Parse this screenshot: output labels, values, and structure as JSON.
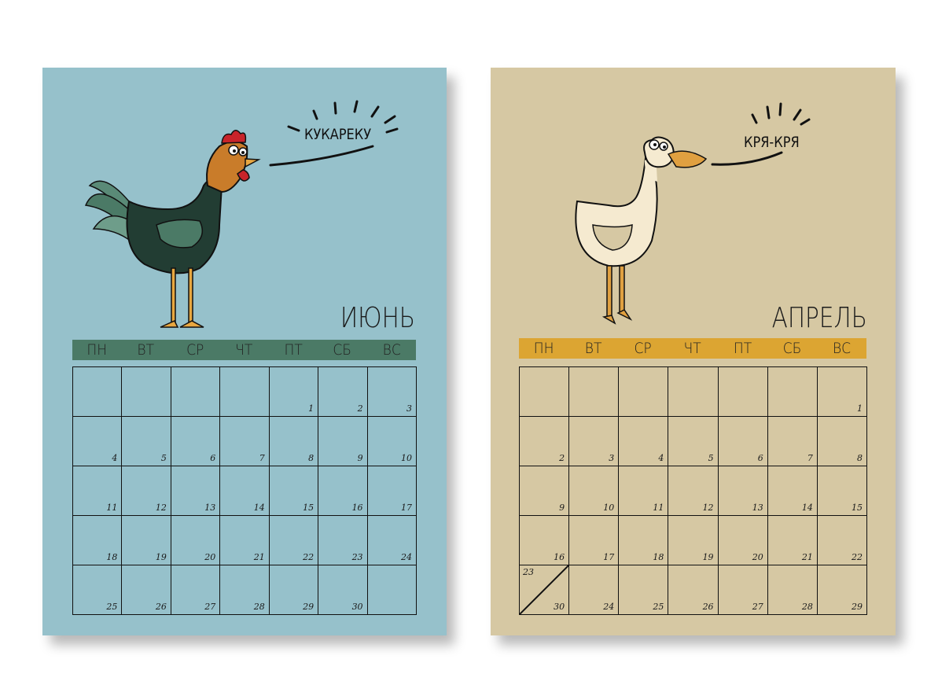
{
  "pages": [
    {
      "id": "june",
      "month": "ИЮНЬ",
      "speech": "КУКАРЕКУ",
      "bar_color": "#4b7a66",
      "bg_color": "#96c1cb",
      "weekdays": [
        "ПН",
        "ВТ",
        "СР",
        "ЧТ",
        "ПТ",
        "СБ",
        "ВС"
      ],
      "cells": [
        "",
        "",
        "",
        "",
        "1",
        "2",
        "3",
        "4",
        "5",
        "6",
        "7",
        "8",
        "9",
        "10",
        "11",
        "12",
        "13",
        "14",
        "15",
        "16",
        "17",
        "18",
        "19",
        "20",
        "21",
        "22",
        "23",
        "24",
        "25",
        "26",
        "27",
        "28",
        "29",
        "30",
        ""
      ]
    },
    {
      "id": "april",
      "month": "АПРЕЛЬ",
      "speech": "КРЯ-КРЯ",
      "bar_color": "#dca532",
      "bg_color": "#d6c8a3",
      "weekdays": [
        "ПН",
        "ВТ",
        "СР",
        "ЧТ",
        "ПТ",
        "СБ",
        "ВС"
      ],
      "cells": [
        "",
        "",
        "",
        "",
        "",
        "",
        "1",
        "2",
        "3",
        "4",
        "5",
        "6",
        "7",
        "8",
        "9",
        "10",
        "11",
        "12",
        "13",
        "14",
        "15",
        "16",
        "17",
        "18",
        "19",
        "20",
        "21",
        "22",
        "23/30",
        "24",
        "25",
        "26",
        "27",
        "28",
        "29"
      ]
    }
  ],
  "icons": {
    "june_animal": "rooster-illustration",
    "april_animal": "goose-illustration"
  }
}
